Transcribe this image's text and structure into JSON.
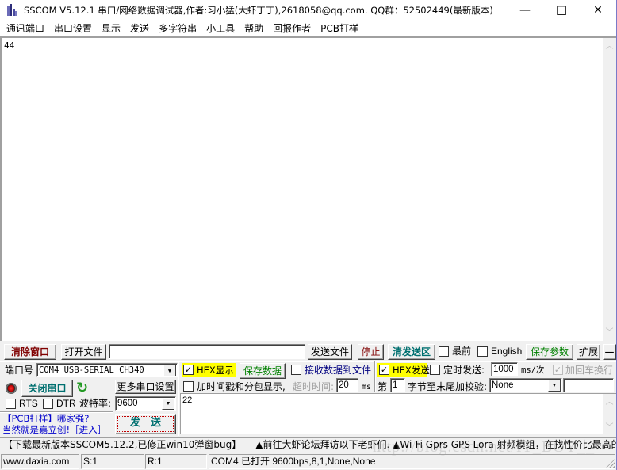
{
  "window": {
    "title": "SSCOM V5.12.1 串口/网络数据调试器,作者:习小猛(大虾丁丁),2618058@qq.com. QQ群：52502449(最新版本)",
    "minimize": "—",
    "maximize": "☐",
    "close": "✕"
  },
  "menu": [
    "通讯端口",
    "串口设置",
    "显示",
    "发送",
    "多字符串",
    "小工具",
    "帮助",
    "回报作者",
    "PCB打样"
  ],
  "receive": {
    "text": "44"
  },
  "toolbar1": {
    "clear_window": "清除窗口",
    "open_file": "打开文件",
    "file_path": "",
    "send_file": "发送文件",
    "stop": "停止",
    "clear_send": "清发送区",
    "topmost_label": "最前",
    "topmost_checked": false,
    "english_label": "English",
    "english_checked": false,
    "save_params": "保存参数",
    "expand": "扩展",
    "collapse": "—"
  },
  "port": {
    "port_label": "端口号",
    "port_value": "COM4 USB-SERIAL CH340",
    "close_port": "关闭串口",
    "more_settings": "更多串口设置",
    "rts_label": "RTS",
    "rts_checked": false,
    "dtr_label": "DTR",
    "dtr_checked": false,
    "baud_label": "波特率:",
    "baud_value": "9600",
    "status_color": "#cc0000"
  },
  "display": {
    "hex_display_label": "HEX显示",
    "hex_display_checked": true,
    "save_data": "保存数据",
    "recv_to_file_label": "接收数据到文件",
    "recv_to_file_checked": false,
    "timestamp_label": "加时间戳和分包显示,",
    "timestamp_checked": false,
    "timeout_label": "超时时间:",
    "timeout_value": "20",
    "timeout_unit": "ms"
  },
  "send_opts": {
    "hex_send_label": "HEX发送",
    "hex_send_checked": true,
    "timed_send_label": "定时发送:",
    "timed_send_checked": false,
    "interval_value": "1000",
    "interval_unit": "ms/次",
    "add_crlf_label": "加回车换行",
    "add_crlf_checked": true,
    "byte_label_prefix": "第",
    "byte_index": "1",
    "checksum_label": "字节至末尾加校验:",
    "checksum_value": "None",
    "checksum_extra": ""
  },
  "promo": {
    "line1": "【PCB打样】哪家强?",
    "line2": "当然就是嘉立创!［进入］"
  },
  "send": {
    "button": "发　送",
    "text": "22"
  },
  "marquee": "【下载最新版本SSCOM5.12.2,已修正win10弹窗bug】　　▲前往大虾论坛拜访以下老虾们. ▲Wi-Fi Gprs GPS Lora 射频模组，在找性价比最高的",
  "statusbar": {
    "website": "www.daxia.com",
    "sent": "S:1",
    "received": "R:1",
    "port_status": "COM4 已打开  9600bps,8,1,None,None"
  },
  "watermark": "http://blog.csdn.net/IT_BOY__",
  "colors": {
    "hex_highlight": "#ffff00",
    "clear_window_text": "#800000",
    "green_text": "#008000",
    "teal_text": "#007070",
    "blue_link": "#0000cc"
  }
}
